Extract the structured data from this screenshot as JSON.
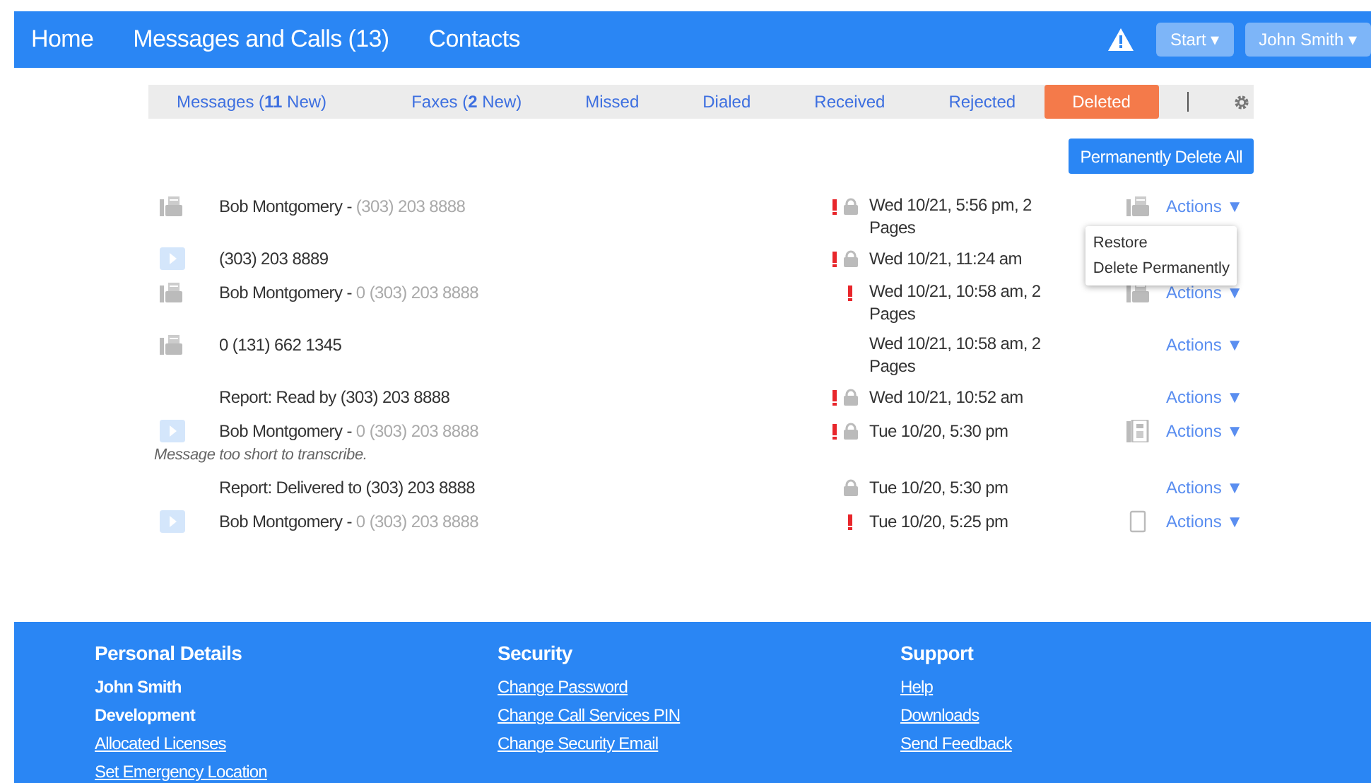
{
  "nav": {
    "links": [
      "Home",
      "Messages and Calls (13)",
      "Contacts"
    ],
    "start_button": "Start ▾",
    "user_button": "John Smith ▾",
    "alert": true
  },
  "tabs": [
    {
      "label": "Messages (**11** New)",
      "selected": false
    },
    {
      "label": "Faxes (**2** New)",
      "selected": false
    },
    {
      "label": "Missed",
      "selected": false
    },
    {
      "label": "Dialed",
      "selected": false
    },
    {
      "label": "Received",
      "selected": false
    },
    {
      "label": "Rejected",
      "selected": false
    },
    {
      "label": "Deleted",
      "selected": true
    }
  ],
  "delete_all_button": "Permanently Delete All",
  "rows": [
    {
      "kind": "fax",
      "caller": "Bob Montgomery -",
      "number": "(303) 203 8888",
      "urgent": true,
      "locked": true,
      "date": "Wed 10/21, 5:56 pm, 2 Pages",
      "device": {
        "kind": "fax"
      },
      "actions": "Actions ▼"
    },
    {
      "kind": "voicemail",
      "caller": "(303) 203 8889",
      "urgent": true,
      "locked": true,
      "date": "Wed 10/21, 11:24 am"
    },
    {
      "kind": "fax",
      "caller": "Bob Montgomery -",
      "number": "0 (303) 203 8888",
      "urgent": true,
      "locked": false,
      "date": "Wed 10/21, 10:58 am, 2 Pages",
      "device": {
        "kind": "fax"
      },
      "actions": "Actions ▼"
    },
    {
      "kind": "fax",
      "caller": "0 (131) 662 1345",
      "urgent": false,
      "locked": false,
      "date": "Wed 10/21, 10:58 am, 2 Pages",
      "actions": "Actions ▼"
    },
    {
      "kind": "report",
      "caller": "Report: Read by (303) 203 8888",
      "urgent": true,
      "locked": true,
      "date": "Wed 10/21, 10:52 am",
      "actions": "Actions ▼"
    },
    {
      "kind": "voicemail",
      "caller": "Bob Montgomery -",
      "number": "0 (303) 203 8888",
      "urgent": true,
      "locked": true,
      "date": "Tue 10/20, 5:30 pm",
      "device": {
        "kind": "deskphone"
      },
      "actions": "Actions ▼",
      "note": "Message too short to transcribe."
    },
    {
      "kind": "report",
      "caller": "Report: Delivered to (303) 203 8888",
      "urgent": false,
      "locked": true,
      "date": "Tue 10/20, 5:30 pm",
      "actions": "Actions ▼"
    },
    {
      "kind": "voicemail",
      "caller": "Bob Montgomery -",
      "number": "0 (303) 203 8888",
      "urgent": true,
      "locked": false,
      "date": "Tue 10/20, 5:25 pm",
      "device": {
        "kind": "mobile"
      },
      "actions": "Actions ▼"
    }
  ],
  "actions_menu": [
    "Restore",
    "Delete Permanently"
  ],
  "footer": [
    {
      "title": "Personal Details",
      "items": [
        {
          "text": "John Smith",
          "link": false
        },
        {
          "text": "Development",
          "link": false
        },
        {
          "text": "Allocated Licenses",
          "link": true
        },
        {
          "text": "Set Emergency Location",
          "link": true
        }
      ]
    },
    {
      "title": "Security",
      "items": [
        {
          "text": "Change Password",
          "link": true
        },
        {
          "text": "Change Call Services PIN",
          "link": true
        },
        {
          "text": "Change Security Email",
          "link": true
        }
      ]
    },
    {
      "title": "Support",
      "items": [
        {
          "text": "Help",
          "link": true
        },
        {
          "text": "Downloads",
          "link": true
        },
        {
          "text": "Send Feedback",
          "link": true
        }
      ]
    }
  ]
}
